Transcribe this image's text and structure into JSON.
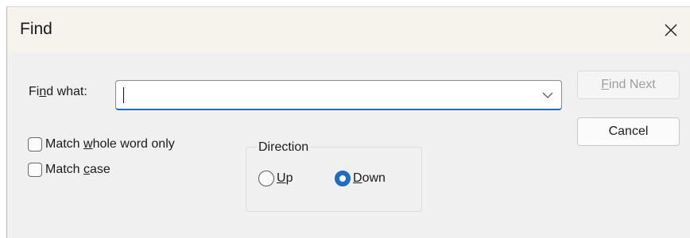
{
  "dialog": {
    "title": "Find",
    "close_icon": "close-icon"
  },
  "find": {
    "label_prefix": "Fi",
    "label_accel": "n",
    "label_suffix": "d what:",
    "value": "",
    "dropdown_icon": "chevron-down-icon"
  },
  "buttons": {
    "find_next_accel": "F",
    "find_next_rest": "ind Next",
    "find_next_enabled": false,
    "cancel": "Cancel"
  },
  "options": {
    "match_whole_word": {
      "prefix": "Match ",
      "accel": "w",
      "suffix": "hole word only",
      "checked": false
    },
    "match_case": {
      "prefix": "Match ",
      "accel": "c",
      "suffix": "ase",
      "checked": false
    }
  },
  "direction": {
    "title": "Direction",
    "up_accel": "U",
    "up_rest": "p",
    "down_accel": "D",
    "down_rest": "own",
    "selected": "Down"
  },
  "colors": {
    "accent": "#1d6cc6",
    "titlebar": "#f6f2ec",
    "dialog_bg": "#f0f0f0"
  }
}
